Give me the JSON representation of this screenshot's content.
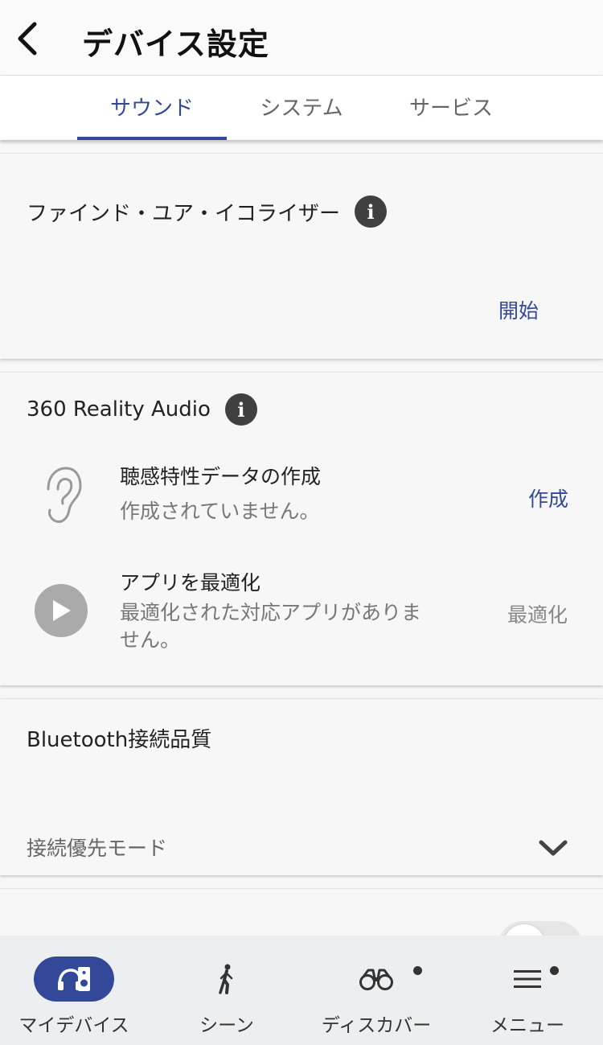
{
  "header": {
    "title": "デバイス設定"
  },
  "tabs": [
    {
      "label": "サウンド",
      "active": true
    },
    {
      "label": "システム",
      "active": false
    },
    {
      "label": "サービス",
      "active": false
    }
  ],
  "equalizer": {
    "title": "ファインド・ユア・イコライザー",
    "action": "開始"
  },
  "reality_audio": {
    "title": "360 Reality Audio",
    "items": [
      {
        "icon": "ear-icon",
        "title": "聴感特性データの作成",
        "subtitle": "作成されていません。",
        "action": "作成"
      },
      {
        "icon": "play-icon",
        "title": "アプリを最適化",
        "subtitle": "最適化された対応アプリがありません。",
        "action": "最適化"
      }
    ]
  },
  "bluetooth": {
    "title": "Bluetooth接続品質",
    "mode": "接続優先モード"
  },
  "bottom_nav": [
    {
      "label": "マイデバイス",
      "icon": "headphones-speaker-icon",
      "active": true
    },
    {
      "label": "シーン",
      "icon": "walking-person-icon",
      "active": false
    },
    {
      "label": "ディスカバー",
      "icon": "binoculars-icon",
      "active": false,
      "badge": true
    },
    {
      "label": "メニュー",
      "icon": "menu-icon",
      "active": false,
      "badge": true
    }
  ],
  "colors": {
    "accent": "#34489a",
    "disabled": "#888888",
    "info_icon": "#404040"
  }
}
